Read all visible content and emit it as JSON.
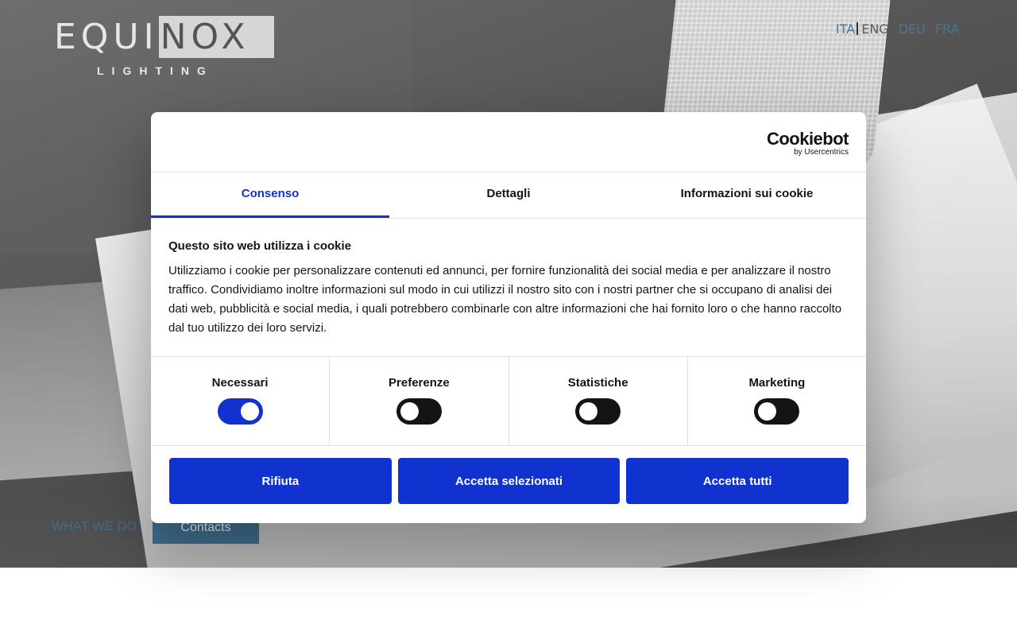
{
  "logo": {
    "word_left": "EQUI",
    "word_right": "NOX",
    "sub": "LIGHTING"
  },
  "languages": {
    "ita": "ITA",
    "eng": "ENG",
    "deu": "DEU",
    "fra": "FRA"
  },
  "hero_nav": {
    "what_we_do": "WHAT WE DO",
    "contacts": "Contacts"
  },
  "cookie_dialog": {
    "brand": "Cookiebot",
    "brand_sub": "by Usercentrics",
    "tabs": [
      {
        "label": "Consenso",
        "active": true
      },
      {
        "label": "Dettagli",
        "active": false
      },
      {
        "label": "Informazioni sui cookie",
        "active": false
      }
    ],
    "title": "Questo sito web utilizza i cookie",
    "text": "Utilizziamo i cookie per personalizzare contenuti ed annunci, per fornire funzionalità dei social media e per analizzare il nostro traffico. Condividiamo inoltre informazioni sul modo in cui utilizzi il nostro sito con i nostri partner che si occupano di analisi dei dati web, pubblicità e social media, i quali potrebbero combinarle con altre informazioni che hai fornito loro o che hanno raccolto dal tuo utilizzo dei loro servizi.",
    "toggles": [
      {
        "label": "Necessari",
        "on": true
      },
      {
        "label": "Preferenze",
        "on": false
      },
      {
        "label": "Statistiche",
        "on": false
      },
      {
        "label": "Marketing",
        "on": false
      }
    ],
    "buttons": {
      "reject": "Rifiuta",
      "accept_selected": "Accetta selezionati",
      "accept_all": "Accetta tutti"
    }
  },
  "colors": {
    "accent_blue": "#1032cf",
    "brand_teal": "#3e6d8d"
  }
}
